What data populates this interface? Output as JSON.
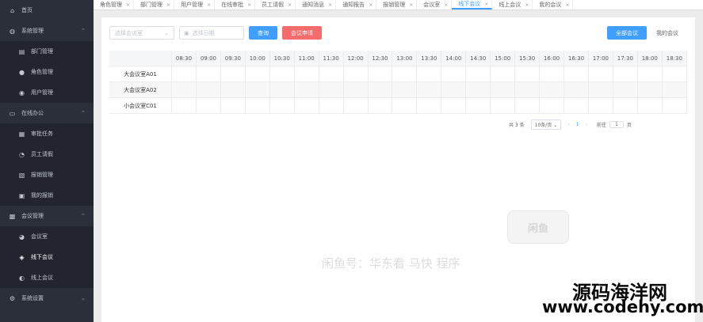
{
  "sidebar": {
    "items": [
      {
        "label": "首页",
        "icon": "home-icon",
        "level": 1,
        "chevron": ""
      },
      {
        "label": "系统管理",
        "icon": "user-group-icon",
        "level": 1,
        "chevron": "⌃"
      },
      {
        "label": "部门管理",
        "icon": "department-icon",
        "level": 2,
        "chevron": ""
      },
      {
        "label": "角色管理",
        "icon": "role-icon",
        "level": 2,
        "chevron": ""
      },
      {
        "label": "用户管理",
        "icon": "user-icon",
        "level": 2,
        "chevron": ""
      },
      {
        "label": "在线办公",
        "icon": "monitor-icon",
        "level": 1,
        "chevron": "⌃"
      },
      {
        "label": "审批任务",
        "icon": "task-icon",
        "level": 2,
        "chevron": ""
      },
      {
        "label": "员工请假",
        "icon": "leave-icon",
        "level": 2,
        "chevron": ""
      },
      {
        "label": "报销管理",
        "icon": "reimburse-icon",
        "level": 2,
        "chevron": ""
      },
      {
        "label": "我的报销",
        "icon": "wallet-icon",
        "level": 2,
        "chevron": ""
      },
      {
        "label": "会议管理",
        "icon": "meeting-icon",
        "level": 1,
        "chevron": "⌃"
      },
      {
        "label": "会议室",
        "icon": "room-icon",
        "level": 2,
        "chevron": ""
      },
      {
        "label": "线下会议",
        "icon": "offline-meeting-icon",
        "level": 2,
        "chevron": "",
        "active": true
      },
      {
        "label": "线上会议",
        "icon": "online-meeting-icon",
        "level": 2,
        "chevron": ""
      },
      {
        "label": "系统设置",
        "icon": "settings-icon",
        "level": 1,
        "chevron": "⌄"
      }
    ]
  },
  "tabs": [
    {
      "label": "角色管理",
      "active": false
    },
    {
      "label": "部门管理",
      "active": false
    },
    {
      "label": "用户管理",
      "active": false
    },
    {
      "label": "在线审批",
      "active": false
    },
    {
      "label": "员工请假",
      "active": false
    },
    {
      "label": "通知消息",
      "active": false
    },
    {
      "label": "通知报告",
      "active": false
    },
    {
      "label": "报销管理",
      "active": false
    },
    {
      "label": "会议室",
      "active": false
    },
    {
      "label": "线下会议",
      "active": true
    },
    {
      "label": "线上会议",
      "active": false
    },
    {
      "label": "我的会议",
      "active": false
    }
  ],
  "tab_close": "×",
  "toolbar": {
    "select_placeholder": "选择会议室",
    "select_arrow": "⌄",
    "date_icon": "▣",
    "date_placeholder": "选择日期",
    "search_label": "查询",
    "book_label": "会议申请",
    "all_label": "全部会议",
    "mine_label": "我的会议"
  },
  "grid": {
    "times": [
      "08:30",
      "09:00",
      "09:30",
      "10:00",
      "10:30",
      "11:00",
      "11:30",
      "12:00",
      "12:30",
      "13:00",
      "13:30",
      "14:00",
      "14:30",
      "15:00",
      "15:30",
      "16:00",
      "16:30",
      "17:00",
      "17:30",
      "18:00",
      "18:30"
    ],
    "rooms": [
      "大会议室A01",
      "大会议室A02",
      "小会议室C01"
    ]
  },
  "pager": {
    "total": "共 3 条",
    "size": "10条/页",
    "size_arrow": "⌄",
    "prev": "‹",
    "page": "1",
    "next": "›",
    "goto": "前往",
    "page_input": "1",
    "unit": "页"
  },
  "watermark": {
    "logo": "闲鱼",
    "text": "闲鱼号：华东看 马快 程序",
    "title": "源码海洋网",
    "url": "www.codehy.com"
  }
}
